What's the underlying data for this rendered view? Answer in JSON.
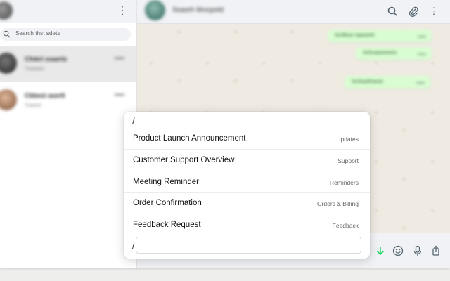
{
  "sidebar": {
    "search_placeholder": "Search thst sdets",
    "chats": [
      {
        "name": "Cfnkrt xsaerts",
        "time": "",
        "preview": "Txwseen",
        "avatar_color": "#3a3a3a"
      },
      {
        "name": "Cbbest asertt",
        "time": "",
        "preview": "Trasent",
        "avatar_color": "#b58a6a"
      }
    ]
  },
  "conversation": {
    "contact_name": "Ssasrh Wvcpotd",
    "messages": [
      {
        "text": "Scrtfescr Iaassertt",
        "time": ""
      },
      {
        "text": "Scfsvaeeeeerts",
        "time": ""
      },
      {
        "text": "Scrfsoofroesst",
        "time": ""
      }
    ]
  },
  "quick_replies": {
    "trigger": "/",
    "items": [
      {
        "title": "Product Launch Announcement",
        "category": "Updates"
      },
      {
        "title": "Customer Support Overview",
        "category": "Support"
      },
      {
        "title": "Meeting Reminder",
        "category": "Reminders"
      },
      {
        "title": "Order Confirmation",
        "category": "Orders & Billing"
      },
      {
        "title": "Feedback Request",
        "category": "Feedback"
      }
    ],
    "input_prefix": "/",
    "input_value": ""
  },
  "colors": {
    "accent_green": "#25d366",
    "bubble_green": "#d9fdd3",
    "chat_background": "#efeae2",
    "panel_header": "#f0f2f5"
  },
  "icons": {
    "menu": "vertical-dots-icon",
    "search": "search-icon",
    "attach": "paperclip-icon",
    "down_arrow": "arrow-down-icon",
    "emoji": "emoji-icon",
    "mic": "microphone-icon",
    "share": "share-icon"
  }
}
